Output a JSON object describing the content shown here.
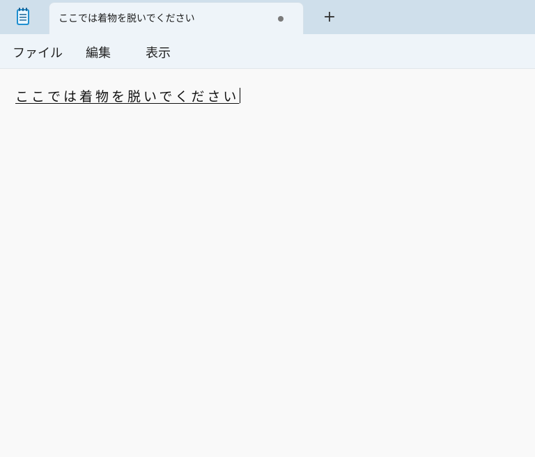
{
  "tab": {
    "title": "ここでは着物を脱いでください",
    "modified_indicator": "unsaved-dot",
    "new_tab_label": "+"
  },
  "app": {
    "icon": "notepad-icon"
  },
  "menu": {
    "file": "ファイル",
    "edit": "編集",
    "view": "表示"
  },
  "editor": {
    "text": "ここでは着物を脱いでください"
  },
  "colors": {
    "tabbar_bg": "#cfdfeb",
    "active_tab_bg": "#eef4f9",
    "editor_bg": "#f9f9f9"
  }
}
